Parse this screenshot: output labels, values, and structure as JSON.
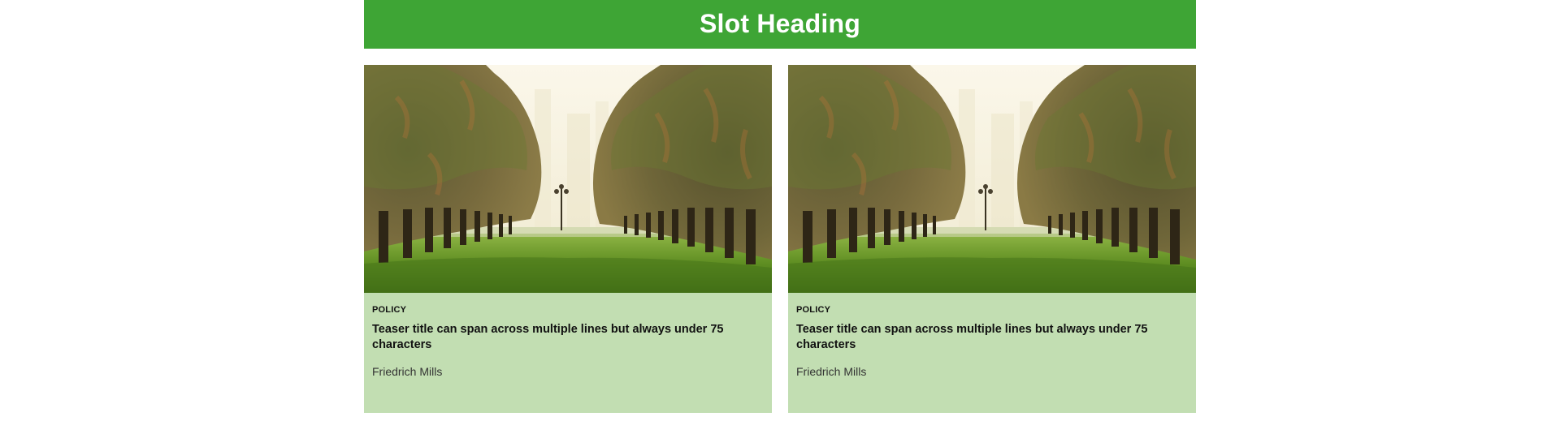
{
  "slot": {
    "heading": "Slot Heading",
    "header_bg": "#3ea535",
    "card_bg": "#c2deb2"
  },
  "cards": [
    {
      "image_icon": "palm-avenue-photo",
      "category": "POLICY",
      "title": "Teaser title can span across multiple lines but always under 75 characters",
      "author": "Friedrich Mills"
    },
    {
      "image_icon": "palm-avenue-photo",
      "category": "POLICY",
      "title": "Teaser title can span across multiple lines but always under 75 characters",
      "author": "Friedrich Mills"
    }
  ]
}
